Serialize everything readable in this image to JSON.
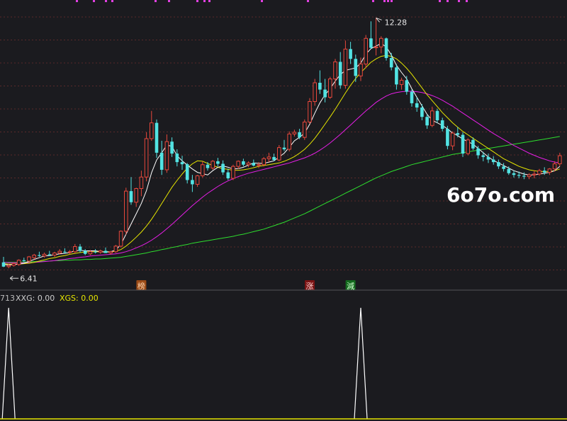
{
  "chart_data": [
    {
      "type": "candlestick",
      "colors": {
        "up": "#e8483c",
        "down": "#52e3e3",
        "ma5": "#ffffff",
        "ma10": "#e6e600",
        "ma20": "#e61ee6",
        "ma60": "#2ede2e",
        "grid": "#5a2a2a"
      },
      "grid": true,
      "ylim": [
        5.9,
        12.7
      ],
      "high_label": "12.28",
      "low_label": "6.41",
      "ohlc": [
        [
          6.55,
          6.68,
          6.44,
          6.45
        ],
        [
          6.45,
          6.52,
          6.41,
          6.48
        ],
        [
          6.48,
          6.55,
          6.45,
          6.52
        ],
        [
          6.5,
          6.62,
          6.47,
          6.6
        ],
        [
          6.6,
          6.66,
          6.56,
          6.58
        ],
        [
          6.58,
          6.7,
          6.55,
          6.68
        ],
        [
          6.66,
          6.75,
          6.62,
          6.72
        ],
        [
          6.72,
          6.8,
          6.68,
          6.7
        ],
        [
          6.7,
          6.78,
          6.66,
          6.74
        ],
        [
          6.74,
          6.82,
          6.7,
          6.72
        ],
        [
          6.72,
          6.8,
          6.68,
          6.77
        ],
        [
          6.77,
          6.86,
          6.74,
          6.81
        ],
        [
          6.8,
          6.88,
          6.76,
          6.79
        ],
        [
          6.79,
          6.84,
          6.74,
          6.8
        ],
        [
          6.8,
          6.98,
          6.76,
          6.92
        ],
        [
          6.92,
          6.98,
          6.78,
          6.82
        ],
        [
          6.82,
          6.86,
          6.72,
          6.75
        ],
        [
          6.75,
          6.84,
          6.72,
          6.8
        ],
        [
          6.8,
          6.86,
          6.76,
          6.79
        ],
        [
          6.79,
          6.85,
          6.75,
          6.82
        ],
        [
          6.82,
          6.9,
          6.78,
          6.77
        ],
        [
          6.77,
          6.82,
          6.73,
          6.8
        ],
        [
          6.8,
          6.96,
          6.77,
          6.93
        ],
        [
          6.93,
          7.3,
          6.9,
          7.28
        ],
        [
          7.28,
          8.3,
          7.2,
          8.22
        ],
        [
          8.22,
          8.55,
          7.9,
          7.96
        ],
        [
          7.96,
          8.3,
          7.85,
          8.28
        ],
        [
          8.28,
          8.7,
          8.1,
          8.55
        ],
        [
          8.55,
          9.6,
          8.45,
          9.45
        ],
        [
          9.45,
          10.1,
          9.4,
          9.82
        ],
        [
          9.82,
          9.9,
          9.0,
          9.12
        ],
        [
          9.12,
          9.4,
          8.6,
          8.72
        ],
        [
          8.72,
          9.55,
          8.65,
          9.38
        ],
        [
          9.38,
          9.48,
          9.02,
          9.1
        ],
        [
          9.1,
          9.2,
          8.8,
          8.9
        ],
        [
          8.9,
          9.05,
          8.72,
          8.85
        ],
        [
          8.85,
          8.88,
          8.4,
          8.48
        ],
        [
          8.48,
          8.6,
          8.2,
          8.38
        ],
        [
          8.38,
          8.6,
          8.32,
          8.58
        ],
        [
          8.58,
          8.92,
          8.54,
          8.84
        ],
        [
          8.84,
          8.9,
          8.7,
          8.76
        ],
        [
          8.76,
          8.95,
          8.72,
          8.92
        ],
        [
          8.92,
          9.0,
          8.8,
          8.86
        ],
        [
          8.86,
          8.94,
          8.6,
          8.66
        ],
        [
          8.66,
          8.75,
          8.48,
          8.52
        ],
        [
          8.52,
          8.84,
          8.48,
          8.8
        ],
        [
          8.8,
          8.94,
          8.74,
          8.92
        ],
        [
          8.92,
          8.98,
          8.8,
          8.84
        ],
        [
          8.84,
          8.92,
          8.78,
          8.88
        ],
        [
          8.88,
          8.96,
          8.8,
          8.82
        ],
        [
          8.82,
          8.9,
          8.76,
          8.84
        ],
        [
          8.84,
          9.02,
          8.8,
          8.98
        ],
        [
          8.98,
          9.12,
          8.9,
          9.02
        ],
        [
          9.02,
          9.1,
          8.92,
          8.95
        ],
        [
          8.95,
          9.3,
          8.92,
          9.24
        ],
        [
          9.24,
          9.42,
          9.16,
          9.2
        ],
        [
          9.2,
          9.62,
          9.15,
          9.56
        ],
        [
          9.56,
          9.66,
          9.5,
          9.6
        ],
        [
          9.6,
          9.68,
          9.44,
          9.48
        ],
        [
          9.48,
          9.9,
          9.42,
          9.84
        ],
        [
          9.84,
          10.4,
          9.8,
          10.32
        ],
        [
          10.32,
          10.85,
          10.22,
          10.76
        ],
        [
          10.76,
          11.05,
          10.5,
          10.6
        ],
        [
          10.6,
          10.85,
          10.3,
          10.42
        ],
        [
          10.42,
          10.9,
          10.38,
          10.85
        ],
        [
          10.85,
          11.32,
          10.62,
          11.25
        ],
        [
          11.25,
          11.48,
          10.62,
          10.7
        ],
        [
          10.7,
          11.75,
          10.62,
          11.55
        ],
        [
          11.55,
          11.72,
          11.2,
          11.32
        ],
        [
          11.32,
          11.42,
          10.78,
          10.92
        ],
        [
          10.92,
          11.35,
          10.8,
          11.2
        ],
        [
          11.2,
          11.88,
          11.1,
          11.8
        ],
        [
          11.8,
          12.2,
          11.55,
          11.58
        ],
        [
          11.58,
          12.28,
          11.4,
          11.6
        ],
        [
          11.6,
          11.85,
          11.45,
          11.8
        ],
        [
          11.8,
          11.82,
          11.28,
          11.34
        ],
        [
          11.34,
          11.46,
          11.05,
          11.12
        ],
        [
          11.12,
          11.2,
          10.6,
          10.72
        ],
        [
          10.72,
          10.88,
          10.6,
          10.82
        ],
        [
          10.82,
          10.92,
          10.48,
          10.55
        ],
        [
          10.55,
          10.6,
          10.2,
          10.28
        ],
        [
          10.28,
          10.42,
          10.08,
          10.18
        ],
        [
          10.18,
          10.26,
          9.88,
          9.96
        ],
        [
          9.96,
          10.02,
          9.68,
          9.76
        ],
        [
          9.76,
          10.2,
          9.72,
          10.1
        ],
        [
          10.1,
          10.15,
          9.82,
          9.88
        ],
        [
          9.88,
          9.94,
          9.62,
          9.68
        ],
        [
          9.68,
          9.75,
          9.2,
          9.28
        ],
        [
          9.28,
          9.62,
          9.18,
          9.58
        ],
        [
          9.58,
          9.72,
          9.48,
          9.54
        ],
        [
          9.54,
          9.6,
          9.02,
          9.1
        ],
        [
          9.1,
          9.46,
          9.06,
          9.42
        ],
        [
          9.42,
          9.48,
          9.18,
          9.22
        ],
        [
          9.22,
          9.28,
          8.98,
          9.06
        ],
        [
          9.06,
          9.14,
          8.92,
          9.02
        ],
        [
          9.02,
          9.1,
          8.88,
          8.96
        ],
        [
          8.96,
          9.04,
          8.84,
          8.9
        ],
        [
          8.9,
          8.96,
          8.74,
          8.8
        ],
        [
          8.8,
          8.88,
          8.68,
          8.74
        ],
        [
          8.74,
          8.8,
          8.6,
          8.64
        ],
        [
          8.64,
          8.7,
          8.54,
          8.6
        ],
        [
          8.6,
          8.68,
          8.52,
          8.58
        ],
        [
          8.58,
          8.66,
          8.5,
          8.56
        ],
        [
          8.56,
          8.64,
          8.5,
          8.6
        ],
        [
          8.6,
          8.7,
          8.52,
          8.62
        ],
        [
          8.62,
          8.74,
          8.58,
          8.7
        ],
        [
          8.7,
          8.78,
          8.6,
          8.66
        ],
        [
          8.66,
          8.76,
          8.6,
          8.74
        ],
        [
          8.74,
          8.92,
          8.68,
          8.86
        ],
        [
          8.86,
          9.12,
          8.8,
          9.05
        ]
      ],
      "ma5": [
        6.5,
        6.49,
        6.5,
        6.51,
        6.53,
        6.57,
        6.62,
        6.66,
        6.7,
        6.71,
        6.73,
        6.75,
        6.76,
        6.78,
        6.82,
        6.83,
        6.82,
        6.82,
        6.82,
        6.8,
        6.79,
        6.8,
        6.84,
        6.97,
        7.21,
        7.45,
        7.69,
        7.93,
        8.23,
        8.65,
        8.95,
        9.12,
        9.3,
        9.27,
        9.05,
        8.93,
        8.83,
        8.74,
        8.66,
        8.63,
        8.6,
        8.7,
        8.78,
        8.81,
        8.78,
        8.74,
        8.75,
        8.78,
        8.83,
        8.88,
        8.87,
        8.87,
        8.9,
        8.93,
        9.02,
        9.11,
        9.25,
        9.4,
        9.48,
        9.58,
        9.79,
        10.05,
        10.29,
        10.48,
        10.62,
        10.8,
        10.95,
        11.05,
        11.08,
        11.11,
        11.22,
        11.43,
        11.56,
        11.62,
        11.68,
        11.6,
        11.41,
        11.17,
        11.0,
        10.85,
        10.62,
        10.42,
        10.22,
        10.02,
        9.88,
        9.82,
        9.76,
        9.68,
        9.58,
        9.52,
        9.44,
        9.38,
        9.32,
        9.22,
        9.12,
        9.02,
        8.94,
        8.88,
        8.82,
        8.76,
        8.7,
        8.66,
        8.62,
        8.6,
        8.6,
        8.62,
        8.64,
        8.66,
        8.7,
        8.8
      ],
      "ma10": [
        6.52,
        6.51,
        6.51,
        6.51,
        6.52,
        6.53,
        6.55,
        6.58,
        6.61,
        6.64,
        6.66,
        6.69,
        6.71,
        6.74,
        6.76,
        6.78,
        6.79,
        6.8,
        6.8,
        6.8,
        6.8,
        6.8,
        6.81,
        6.85,
        6.93,
        7.03,
        7.14,
        7.26,
        7.4,
        7.56,
        7.74,
        7.93,
        8.12,
        8.31,
        8.47,
        8.62,
        8.76,
        8.86,
        8.93,
        8.92,
        8.87,
        8.82,
        8.78,
        8.75,
        8.73,
        8.71,
        8.71,
        8.72,
        8.74,
        8.77,
        8.8,
        8.82,
        8.84,
        8.86,
        8.88,
        8.92,
        8.97,
        9.03,
        9.11,
        9.2,
        9.32,
        9.46,
        9.62,
        9.79,
        9.96,
        10.14,
        10.33,
        10.52,
        10.7,
        10.86,
        11.0,
        11.12,
        11.24,
        11.32,
        11.38,
        11.4,
        11.38,
        11.32,
        11.22,
        11.1,
        10.96,
        10.8,
        10.64,
        10.48,
        10.34,
        10.2,
        10.06,
        9.94,
        9.82,
        9.72,
        9.62,
        9.54,
        9.46,
        9.38,
        9.3,
        9.22,
        9.14,
        9.06,
        8.98,
        8.92,
        8.86,
        8.8,
        8.76,
        8.72,
        8.7,
        8.68,
        8.68,
        8.68,
        8.7,
        8.74
      ],
      "ma20": [
        6.55,
        6.54,
        6.54,
        6.54,
        6.54,
        6.54,
        6.55,
        6.56,
        6.57,
        6.58,
        6.59,
        6.61,
        6.62,
        6.64,
        6.65,
        6.67,
        6.68,
        6.7,
        6.71,
        6.72,
        6.73,
        6.74,
        6.75,
        6.77,
        6.8,
        6.84,
        6.89,
        6.94,
        7.0,
        7.07,
        7.15,
        7.24,
        7.34,
        7.44,
        7.55,
        7.66,
        7.77,
        7.88,
        7.98,
        8.08,
        8.17,
        8.25,
        8.33,
        8.4,
        8.46,
        8.51,
        8.56,
        8.6,
        8.64,
        8.67,
        8.7,
        8.73,
        8.76,
        8.79,
        8.82,
        8.85,
        8.88,
        8.92,
        8.96,
        9.0,
        9.05,
        9.11,
        9.18,
        9.26,
        9.35,
        9.45,
        9.55,
        9.66,
        9.77,
        9.88,
        9.99,
        10.1,
        10.2,
        10.3,
        10.38,
        10.45,
        10.5,
        10.53,
        10.55,
        10.56,
        10.56,
        10.55,
        10.53,
        10.5,
        10.46,
        10.41,
        10.35,
        10.28,
        10.21,
        10.13,
        10.05,
        9.97,
        9.89,
        9.81,
        9.73,
        9.65,
        9.57,
        9.5,
        9.43,
        9.36,
        9.29,
        9.23,
        9.17,
        9.11,
        9.06,
        9.01,
        8.97,
        8.93,
        8.9,
        8.88
      ],
      "ma60": [
        6.55,
        6.55,
        6.55,
        6.55,
        6.56,
        6.56,
        6.57,
        6.57,
        6.58,
        6.58,
        6.59,
        6.59,
        6.6,
        6.6,
        6.61,
        6.61,
        6.62,
        6.62,
        6.63,
        6.63,
        6.64,
        6.65,
        6.66,
        6.67,
        6.69,
        6.71,
        6.73,
        6.75,
        6.77,
        6.8,
        6.82,
        6.85,
        6.87,
        6.9,
        6.92,
        6.95,
        6.97,
        7.0,
        7.02,
        7.04,
        7.06,
        7.08,
        7.1,
        7.12,
        7.14,
        7.16,
        7.19,
        7.21,
        7.24,
        7.27,
        7.3,
        7.33,
        7.37,
        7.41,
        7.45,
        7.49,
        7.54,
        7.59,
        7.64,
        7.69,
        7.75,
        7.81,
        7.87,
        7.93,
        7.99,
        8.05,
        8.11,
        8.17,
        8.23,
        8.29,
        8.35,
        8.41,
        8.47,
        8.53,
        8.58,
        8.63,
        8.68,
        8.72,
        8.76,
        8.8,
        8.84,
        8.87,
        8.9,
        8.93,
        8.96,
        8.99,
        9.02,
        9.05,
        9.08,
        9.1,
        9.12,
        9.14,
        9.16,
        9.18,
        9.2,
        9.22,
        9.24,
        9.26,
        9.28,
        9.3,
        9.32,
        9.34,
        9.36,
        9.38,
        9.4,
        9.42,
        9.44,
        9.46,
        9.48,
        9.5
      ],
      "badges": [
        {
          "text": "榜",
          "index": 27,
          "bg": "#9a4a16",
          "fg": "#ffd6b0"
        },
        {
          "text": "涨",
          "index": 60,
          "bg": "#7a1414",
          "fg": "#ffd0d0"
        },
        {
          "text": "減",
          "index": 68,
          "bg": "#146a1e",
          "fg": "#d0ffd0"
        }
      ]
    },
    {
      "type": "line",
      "indicator_label": "713",
      "series": [
        {
          "name": "XXG",
          "value": "0.00",
          "color": "#ffffff"
        },
        {
          "name": "XGS",
          "value": "0.00",
          "color": "#e6e600"
        }
      ],
      "signal": [
        0,
        1,
        0,
        0,
        0,
        0,
        0,
        0,
        0,
        0,
        0,
        0,
        0,
        0,
        0,
        0,
        0,
        0,
        0,
        0,
        0,
        0,
        0,
        0,
        0,
        0,
        0,
        0,
        0,
        0,
        0,
        0,
        0,
        0,
        0,
        0,
        0,
        0,
        0,
        0,
        0,
        0,
        0,
        0,
        0,
        0,
        0,
        0,
        0,
        0,
        0,
        0,
        0,
        0,
        0,
        0,
        0,
        0,
        0,
        0,
        0,
        0,
        0,
        0,
        0,
        0,
        0,
        0,
        0,
        0,
        1,
        0,
        0,
        0,
        0,
        0,
        0,
        0,
        0,
        0,
        0,
        0,
        0,
        0,
        0,
        0,
        0,
        0,
        0,
        0,
        0,
        0,
        0,
        0,
        0,
        0,
        0,
        0,
        0,
        0,
        0,
        0,
        0,
        0,
        0,
        0,
        0,
        0,
        0,
        0
      ]
    }
  ],
  "watermark": "6o7o.com",
  "menu_dots_color": "#e040e0"
}
